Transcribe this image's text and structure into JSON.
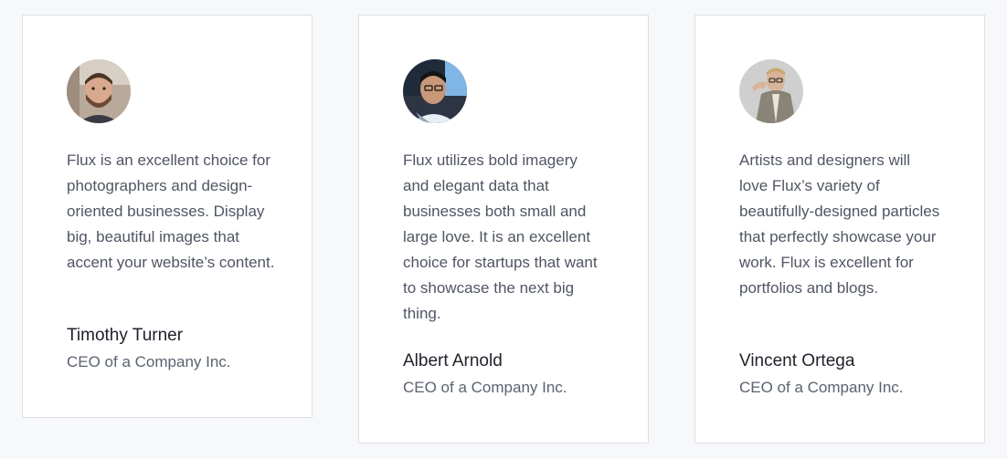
{
  "testimonials": [
    {
      "avatar_icon": "avatar-photo-bearded-man",
      "quote": "Flux is an excellent choice for photographers and design-oriented businesses. Display big, beautiful images that accent your website’s content.",
      "name": "Timothy Turner",
      "role": "CEO of a Company Inc."
    },
    {
      "avatar_icon": "avatar-photo-man-in-car",
      "quote": "Flux utilizes bold imagery and elegant data that businesses both small and large love. It is an excellent choice for startups that want to showcase the next big thing.",
      "name": "Albert Arnold",
      "role": "CEO of a Company Inc."
    },
    {
      "avatar_icon": "avatar-photo-man-with-glasses",
      "quote": "Artists and designers will love Flux’s variety of beautifully-designed particles that perfectly showcase your work. Flux is excellent for portfolios and blogs.",
      "name": "Vincent Ortega",
      "role": "CEO of a Company Inc."
    }
  ],
  "colors": {
    "page_background": "#f7f8fa",
    "card_background": "#ffffff",
    "card_border": "#dcdfe5",
    "quote_text": "#4f5563",
    "name_text": "#20232b",
    "role_text": "#5b6170"
  }
}
